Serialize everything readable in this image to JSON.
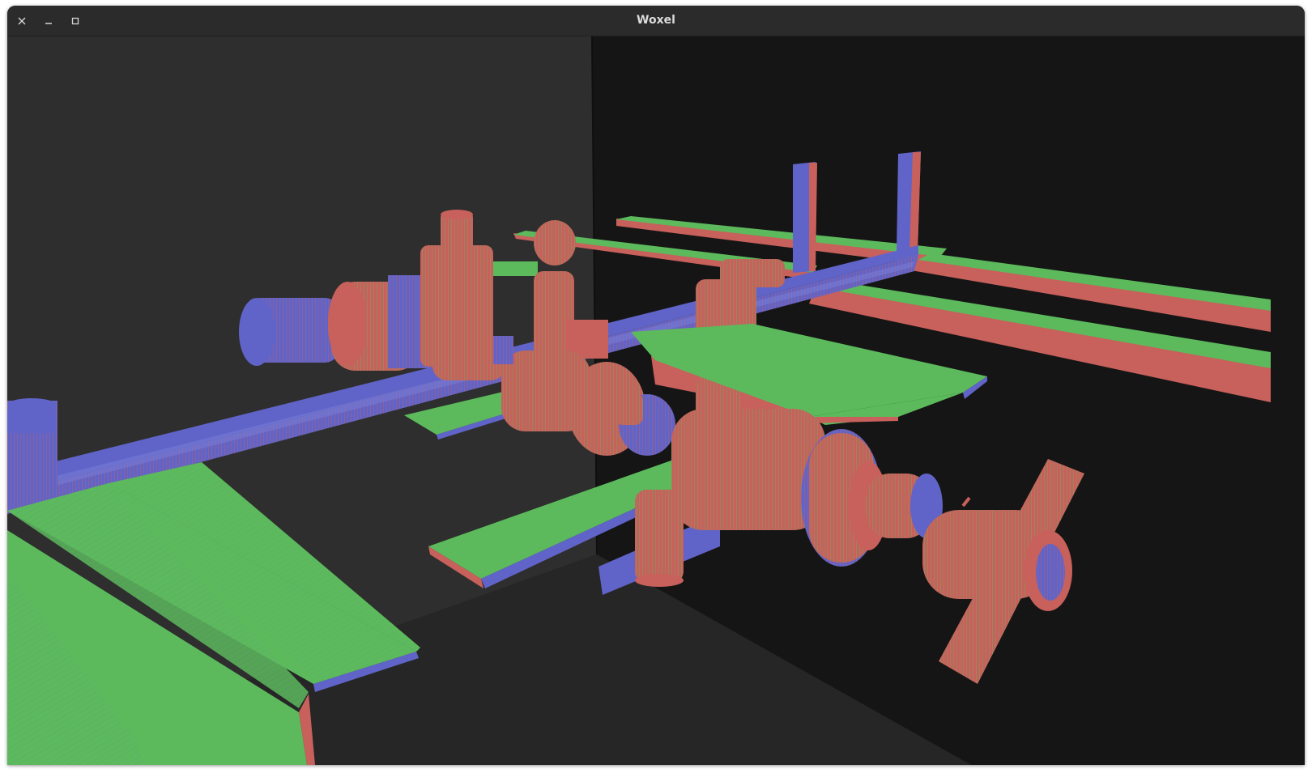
{
  "window": {
    "title": "Woxel"
  },
  "controls": [
    "close-icon",
    "minimize-icon",
    "maximize-icon"
  ],
  "colors": {
    "titlebar": "#2b2b2b",
    "wall_left": "#2e2e2e",
    "wall_right": "#151515",
    "floor": "#262626",
    "voxel_red": "#c8605c",
    "voxel_green": "#5cba5c",
    "voxel_blue": "#6064c8"
  }
}
